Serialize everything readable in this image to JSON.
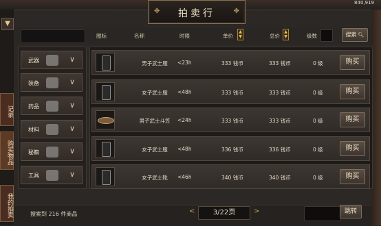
{
  "top_right": "840,919",
  "title": "拍卖行",
  "left_rail": {
    "tab_record": "记录",
    "tab_buy": "购买物品",
    "tab_mine": "我的拍卖"
  },
  "header": {
    "search_input_value": "",
    "col_icon": "图标",
    "col_name": "名称",
    "col_time": "时限",
    "col_unit_price": "单价",
    "col_total_price": "总价",
    "col_level": "级数",
    "search_button": "搜索"
  },
  "categories": [
    {
      "label": "武器",
      "icon": "axe-icon"
    },
    {
      "label": "装备",
      "icon": "armor-icon"
    },
    {
      "label": "药品",
      "icon": "potion-icon"
    },
    {
      "label": "材料",
      "icon": "material-icon"
    },
    {
      "label": "秘籍",
      "icon": "book-icon"
    },
    {
      "label": "工具",
      "icon": "tool-icon"
    }
  ],
  "items": [
    {
      "name": "男子武士服",
      "time": "<23h",
      "unit_price": "333 钱币",
      "total_price": "333 钱币",
      "level": "0 级",
      "buy": "购买",
      "icon": "armor-icon"
    },
    {
      "name": "女子武士服",
      "time": "<48h",
      "unit_price": "333 钱币",
      "total_price": "333 钱币",
      "level": "0 级",
      "buy": "购买",
      "icon": "armor-icon"
    },
    {
      "name": "男子武士斗笠",
      "time": "<24h",
      "unit_price": "333 钱币",
      "total_price": "333 钱币",
      "level": "0 级",
      "buy": "购买",
      "icon": "hat-icon"
    },
    {
      "name": "女子武士服",
      "time": "<48h",
      "unit_price": "336 钱币",
      "total_price": "336 钱币",
      "level": "0 级",
      "buy": "购买",
      "icon": "armor-icon"
    },
    {
      "name": "女子武士靴",
      "time": "<46h",
      "unit_price": "340 钱币",
      "total_price": "340 钱币",
      "level": "0 级",
      "buy": "购买",
      "icon": "boots-icon"
    }
  ],
  "footer": {
    "result_text": "搜索到 216 件商品",
    "page_text": "3/22页",
    "jump_button": "跳转",
    "jump_input_value": ""
  }
}
